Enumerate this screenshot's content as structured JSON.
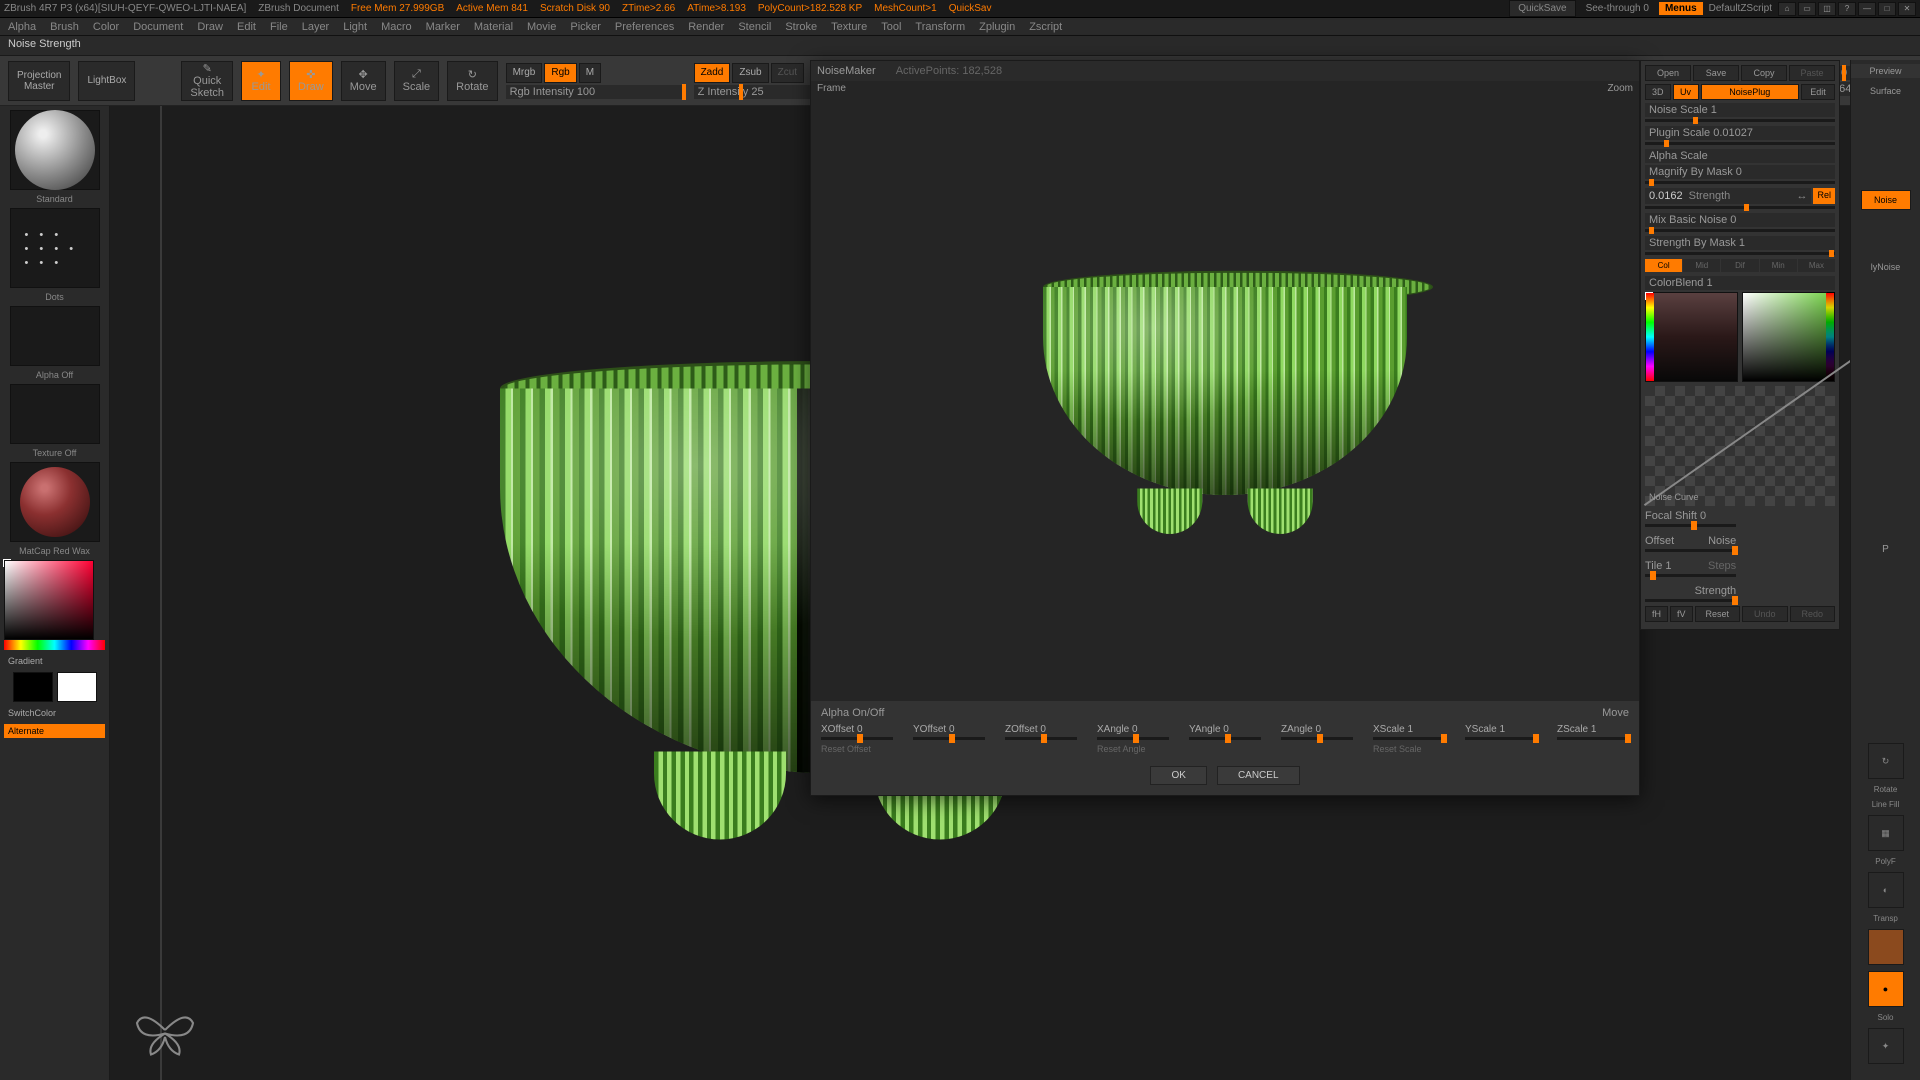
{
  "topbar": {
    "title": "ZBrush 4R7 P3 (x64)[SIUH-QEYF-QWEO-LJTI-NAEA]",
    "doc": "ZBrush Document",
    "free_mem": "Free Mem 27.999GB",
    "active_mem": "Active Mem 841",
    "scratch": "Scratch Disk 90",
    "ztime": "ZTime>2.66",
    "atime": "ATime>8.193",
    "poly": "PolyCount>182.528 KP",
    "mesh": "MeshCount>1",
    "quicksave_on": "QuickSav",
    "quicksave_btn": "QuickSave",
    "seethrough": "See-through  0",
    "menus": "Menus",
    "default": "DefaultZScript"
  },
  "menubar": [
    "Alpha",
    "Brush",
    "Color",
    "Document",
    "Draw",
    "Edit",
    "File",
    "Layer",
    "Light",
    "Macro",
    "Marker",
    "Material",
    "Movie",
    "Picker",
    "Preferences",
    "Render",
    "Stencil",
    "Stroke",
    "Texture",
    "Tool",
    "Transform",
    "Zplugin",
    "Zscript"
  ],
  "hint": "Noise Strength",
  "toolbar": {
    "projection": "Projection\nMaster",
    "lightbox": "LightBox",
    "quicksketch": "Quick\nSketch",
    "edit": "Edit",
    "draw": "Draw",
    "move": "Move",
    "scale": "Scale",
    "rotate": "Rotate",
    "mrgb": "Mrgb",
    "rgb": "Rgb",
    "m": "M",
    "rgb_intensity": "Rgb Intensity 100",
    "zadd": "Zadd",
    "zsub": "Zsub",
    "zcut": "Zcut",
    "z_intensity": "Z Intensity 25",
    "focal_shift": "Focal Shift 0",
    "draw_size": "Draw Size 64"
  },
  "left": {
    "standard": "Standard",
    "dots": "Dots",
    "alpha_off": "Alpha Off",
    "texture_off": "Texture Off",
    "matcap": "MatCap Red Wax",
    "gradient": "Gradient",
    "switchcolor": "SwitchColor",
    "alternate": "Alternate"
  },
  "noise_header": {
    "title": "NoiseMaker",
    "active": "ActivePoints: 182,528",
    "frame": "Frame",
    "zoom": "Zoom",
    "alpha": "Alpha On/Off",
    "move": "Move"
  },
  "noise_sliders": {
    "xoffset": "XOffset 0",
    "yoffset": "YOffset 0",
    "zoffset": "ZOffset 0",
    "xangle": "XAngle 0",
    "yangle": "YAngle 0",
    "zangle": "ZAngle 0",
    "xscale": "XScale 1",
    "yscale": "YScale 1",
    "zscale": "ZScale 1",
    "reset_offset": "Reset Offset",
    "reset_angle": "Reset Angle",
    "reset_scale": "Reset Scale",
    "ok": "OK",
    "cancel": "CANCEL"
  },
  "side": {
    "preview": "Preview",
    "surface": "Surface",
    "open": "Open",
    "save": "Save",
    "copy": "Copy",
    "paste": "Paste",
    "three_d": "3D",
    "uv": "Uv",
    "noiseplug": "NoisePlug",
    "edit": "Edit",
    "noise_scale": "Noise Scale  1",
    "plugin_scale": "Plugin Scale  0.01027",
    "alpha_scale": "Alpha Scale",
    "magnify": "Magnify By Mask 0",
    "strength_val": "0.0162",
    "strength_lbl": "Strength",
    "rel": "Rel",
    "mix_basic": "Mix Basic Noise 0",
    "strength_mask": "Strength By Mask 1",
    "modes": [
      "Col",
      "Mid",
      "Dif",
      "Min",
      "Max"
    ],
    "colorblend": "ColorBlend 1",
    "noise_curve": "Noise Curve",
    "focal": "Focal Shift 0",
    "offset": "Offset",
    "noise": "Noise",
    "tile": "Tile 1",
    "steps": "Steps",
    "strength2": "Strength",
    "fh": "fH",
    "fv": "fV",
    "reset": "Reset",
    "undo": "Undo",
    "redo": "Redo",
    "p": "P",
    "applynoise": "lyNoise"
  },
  "rail": {
    "rotate": "Rotate",
    "linefill": "Line Fill",
    "polyf": "PolyF",
    "transp": "Transp",
    "solo": "Solo"
  }
}
